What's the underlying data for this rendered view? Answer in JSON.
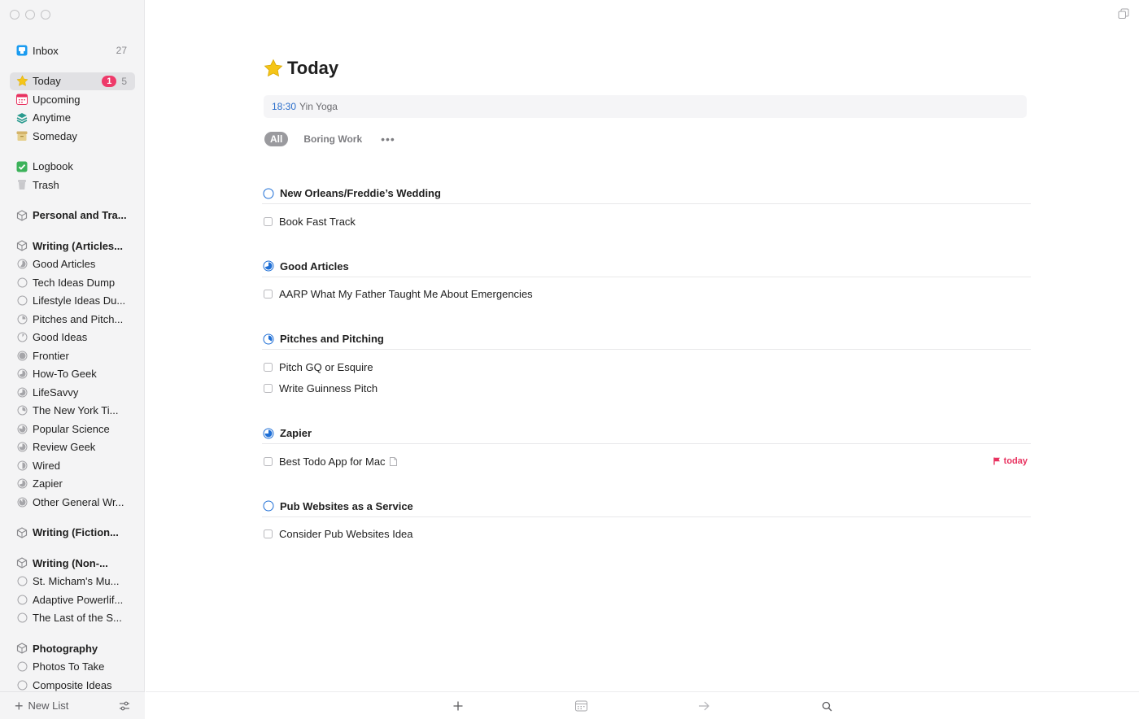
{
  "sidebar": {
    "inbox": {
      "label": "Inbox",
      "count": "27"
    },
    "today": {
      "label": "Today",
      "badge": "1",
      "count": "5"
    },
    "upcoming": {
      "label": "Upcoming"
    },
    "anytime": {
      "label": "Anytime"
    },
    "someday": {
      "label": "Someday"
    },
    "logbook": {
      "label": "Logbook"
    },
    "trash": {
      "label": "Trash"
    },
    "areas": [
      {
        "label": "Personal and Tra..."
      },
      {
        "label": "Writing (Articles..."
      },
      {
        "label": "Writing (Fiction..."
      },
      {
        "label": "Writing (Non-..."
      },
      {
        "label": "Photography"
      }
    ],
    "writing_articles_projects": [
      "Good Articles",
      "Tech Ideas Dump",
      "Lifestyle Ideas Du...",
      "Pitches and Pitch...",
      "Good Ideas",
      "Frontier",
      "How-To Geek",
      "LifeSavvy",
      "The New York Ti...",
      "Popular Science",
      "Review Geek",
      "Wired",
      "Zapier",
      "Other General Wr..."
    ],
    "writing_nonfiction_projects": [
      "St. Micham's Mu...",
      "Adaptive Powerlif...",
      "The Last of the S..."
    ],
    "photography_projects": [
      "Photos To Take",
      "Composite Ideas"
    ],
    "new_list_label": "New List"
  },
  "main": {
    "title": "Today",
    "event": {
      "time": "18:30",
      "name": "Yin Yoga"
    },
    "tags": {
      "all": "All",
      "boring": "Boring Work"
    },
    "projects": [
      {
        "name": "New Orleans/Freddie’s Wedding",
        "tasks": [
          "Book Fast Track"
        ]
      },
      {
        "name": "Good Articles",
        "tasks": [
          "AARP What My Father Taught Me About Emergencies"
        ]
      },
      {
        "name": "Pitches and Pitching",
        "tasks": [
          "Pitch GQ or Esquire",
          "Write Guinness Pitch"
        ]
      },
      {
        "name": "Zapier",
        "tasks": [
          "Best Todo App for Mac"
        ],
        "deadline": "today"
      },
      {
        "name": "Pub Websites as a Service",
        "tasks": [
          "Consider Pub Websites Idea"
        ]
      }
    ]
  },
  "colors": {
    "accent_blue": "#2a6ecb",
    "deadline_red": "#e8315f",
    "badge_pink": "#ee3a6a",
    "star_yellow": "#f5c518"
  },
  "icons": {
    "bottom_bar": [
      "plus-icon",
      "calendar-icon",
      "arrow-right-icon",
      "search-icon"
    ]
  }
}
